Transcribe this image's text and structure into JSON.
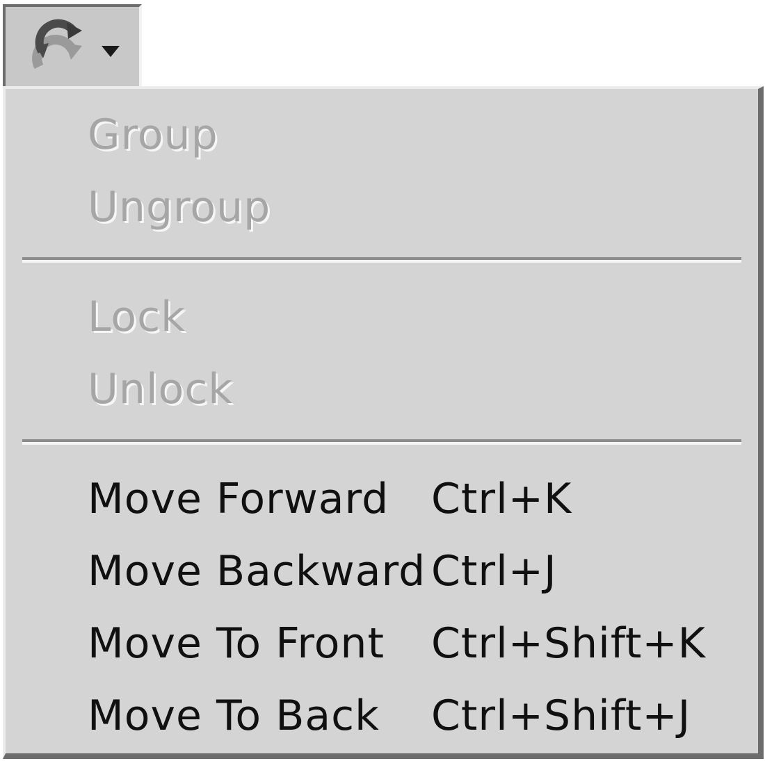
{
  "toolbar": {
    "button_icon": "reorder-objects-icon",
    "arrow_icon": "chevron-down-icon"
  },
  "menu": {
    "groups": [
      [
        {
          "label": "Group",
          "shortcut": "",
          "enabled": false
        },
        {
          "label": "Ungroup",
          "shortcut": "",
          "enabled": false
        }
      ],
      [
        {
          "label": "Lock",
          "shortcut": "",
          "enabled": false
        },
        {
          "label": "Unlock",
          "shortcut": "",
          "enabled": false
        }
      ],
      [
        {
          "label": "Move Forward",
          "shortcut": "Ctrl+K",
          "enabled": true
        },
        {
          "label": "Move Backward",
          "shortcut": "Ctrl+J",
          "enabled": true
        },
        {
          "label": "Move To Front",
          "shortcut": "Ctrl+Shift+K",
          "enabled": true
        },
        {
          "label": "Move To Back",
          "shortcut": "Ctrl+Shift+J",
          "enabled": true
        }
      ]
    ]
  },
  "colors": {
    "menu_background": "#d4d4d4",
    "enabled_text": "#101010",
    "disabled_text": "#a6a6a6"
  }
}
